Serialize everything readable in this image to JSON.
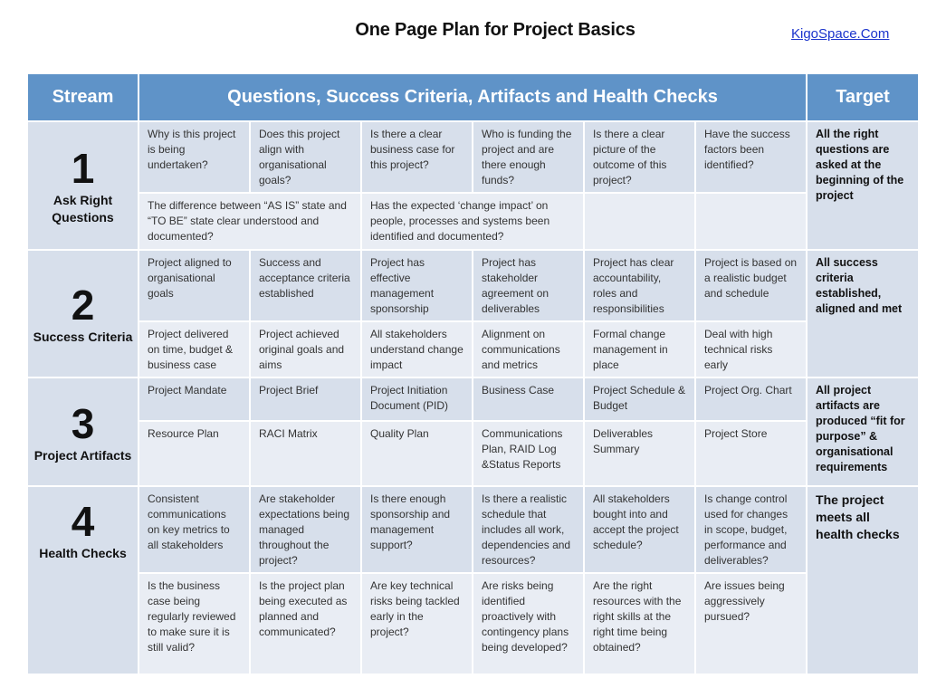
{
  "page": {
    "title": "One Page Plan for Project Basics",
    "site_link": "KigoSpace.Com"
  },
  "colors": {
    "header_bg": "#5f93c8",
    "header_text": "#ffffff",
    "cell_dark": "#d7dfeb",
    "cell_light": "#e9edf4",
    "link": "#1a33cc"
  },
  "table": {
    "headers": {
      "stream": "Stream",
      "questions": "Questions, Success Criteria, Artifacts and Health Checks",
      "target": "Target"
    },
    "rows": [
      {
        "number": "1",
        "label": "Ask Right Questions",
        "target": "All the right questions are asked at the beginning of the project",
        "top": [
          "Why is this project is being undertaken?",
          "Does this project align with organisational goals?",
          "Is there a clear business case for this project?",
          "Who is funding the project and are there enough funds?",
          "Is there a clear picture of the outcome of this project?",
          "Have the success factors been identified?"
        ],
        "bottom": [
          "The difference between “AS IS” state and  “TO BE” state clear understood and documented?",
          "Has the expected ‘change impact’ on people, processes and systems been identified and documented?",
          "",
          ""
        ]
      },
      {
        "number": "2",
        "label": "Success Criteria",
        "target": "All success criteria established, aligned and met",
        "top": [
          "Project aligned to organisational goals",
          "Success and acceptance criteria established",
          "Project has effective management sponsorship",
          "Project has stakeholder agreement on deliverables",
          "Project has clear accountability, roles and responsibilities",
          "Project is based on a realistic budget and schedule"
        ],
        "bottom": [
          "Project delivered on time,  budget & business case",
          "Project achieved original goals and aims",
          "All stakeholders understand change impact",
          "Alignment on communications and metrics",
          "Formal change management in place",
          "Deal with high technical risks early"
        ]
      },
      {
        "number": "3",
        "label": "Project Artifacts",
        "target": "All project artifacts are produced “fit for purpose” & organisational requirements",
        "top": [
          "Project Mandate",
          "Project Brief",
          "Project Initiation Document (PID)",
          "Business Case",
          "Project Schedule & Budget",
          "Project Org. Chart"
        ],
        "bottom": [
          "Resource Plan",
          "RACI Matrix",
          "Quality Plan",
          "Communications Plan, RAID Log &Status Reports",
          "Deliverables Summary",
          "Project Store"
        ]
      },
      {
        "number": "4",
        "label": "Health Checks",
        "target": "The project meets all health checks",
        "top": [
          "Consistent communications on key metrics to all stakeholders",
          "Are stakeholder expectations being managed throughout the project?",
          "Is there enough sponsorship and management support?",
          "Is there a realistic schedule that includes all work, dependencies and resources?",
          "All stakeholders bought into and accept the project schedule?",
          "Is change control used for changes in scope, budget, performance and deliverables?"
        ],
        "bottom": [
          "Is the business case being regularly reviewed to make sure it is still valid?",
          "Is the project plan being executed as planned and communicated?",
          "Are key technical risks being tackled early in the project?",
          "Are risks being identified proactively with contingency plans being developed?",
          "Are the right resources with the right skills at the right time being obtained?",
          "Are issues being aggressively pursued?"
        ]
      }
    ]
  }
}
